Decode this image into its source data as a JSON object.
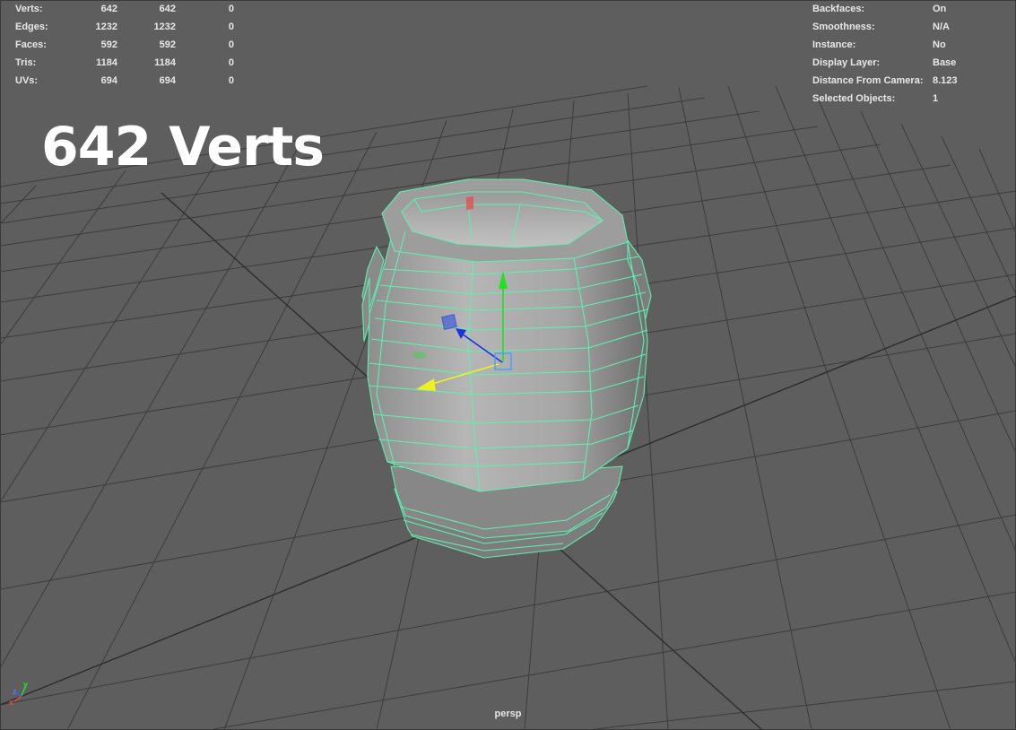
{
  "stats": {
    "rows": [
      {
        "label": "Verts:",
        "a": "642",
        "b": "642",
        "c": "0"
      },
      {
        "label": "Edges:",
        "a": "1232",
        "b": "1232",
        "c": "0"
      },
      {
        "label": "Faces:",
        "a": "592",
        "b": "592",
        "c": "0"
      },
      {
        "label": "Tris:",
        "a": "1184",
        "b": "1184",
        "c": "0"
      },
      {
        "label": "UVs:",
        "a": "694",
        "b": "694",
        "c": "0"
      }
    ]
  },
  "info": {
    "rows": [
      {
        "label": "Backfaces:",
        "value": "On"
      },
      {
        "label": "Smoothness:",
        "value": "N/A"
      },
      {
        "label": "Instance:",
        "value": "No"
      },
      {
        "label": "Display Layer:",
        "value": "Base"
      },
      {
        "label": "Distance From Camera:",
        "value": "8.123"
      },
      {
        "label": "Selected Objects:",
        "value": "1"
      }
    ]
  },
  "overlay_title": "642 Verts",
  "camera_name": "persp",
  "axis_labels": {
    "x": "x",
    "y": "y",
    "z": "z"
  },
  "colors": {
    "background": "#5e5e5e",
    "grid": "#3c3c3c",
    "wireframe": "#5ef0b0",
    "mesh": "#a8a8a8",
    "manip_x": "#e84a4a",
    "manip_y": "#22e022",
    "manip_z": "#2030e0",
    "manip_active": "#f0f020",
    "manip_center": "#40a0ff"
  },
  "icons": [
    "view-axis-icon",
    "move-manipulator-icon"
  ]
}
